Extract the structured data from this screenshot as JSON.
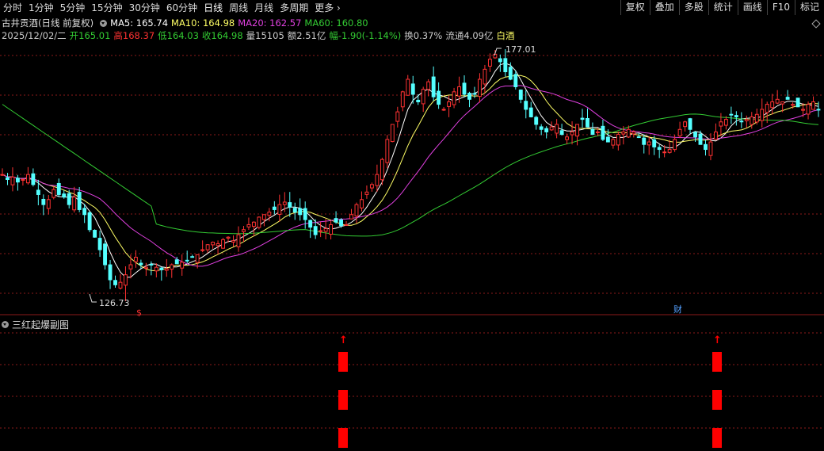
{
  "toolbar": {
    "tabs": [
      "分时",
      "1分钟",
      "5分钟",
      "15分钟",
      "30分钟",
      "60分钟",
      "日线",
      "周线",
      "月线",
      "多周期",
      "更多"
    ],
    "active_tab": "日线",
    "more_arrow": "›",
    "right_buttons": [
      "复权",
      "叠加",
      "多股",
      "统计",
      "画线",
      "F10",
      "标记"
    ]
  },
  "info": {
    "stock_name": "古井贡酒(日线 前复权)",
    "ma5": "MA5: 165.74",
    "ma10": "MA10: 164.98",
    "ma20": "MA20: 162.57",
    "ma60": "MA60: 160.80",
    "date": "2025/12/02/二",
    "open": "开165.01",
    "high": "高168.37",
    "low": "低164.03",
    "close": "收164.98",
    "volume": "量15105",
    "amount": "额2.51亿",
    "change": "幅-1.90(-1.14%)",
    "turnover": "换0.37%",
    "float_cap": "流通4.09亿",
    "sector": "白酒"
  },
  "annotations": {
    "max_label": "177.01",
    "min_label": "126.73",
    "dollar_mark": "$",
    "cai_mark": "财"
  },
  "indicator": {
    "name": "三红起爆副图",
    "signal_arrow": "↑"
  },
  "colors": {
    "background": "#000000",
    "up": "#ff3232",
    "down": "#54ffff",
    "ma5": "#ffffff",
    "ma10": "#ffff66",
    "ma20": "#e040e0",
    "ma60": "#33cc33",
    "signal": "#ff0000",
    "grid": "#8b1a1a"
  },
  "chart_data": {
    "type": "candlestick",
    "y_range": [
      126.73,
      177.01
    ],
    "max_price": 177.01,
    "min_price": 126.73,
    "last_candle": {
      "open": 165.01,
      "high": 168.37,
      "low": 164.03,
      "close": 164.98
    },
    "signal_bars": 2
  }
}
